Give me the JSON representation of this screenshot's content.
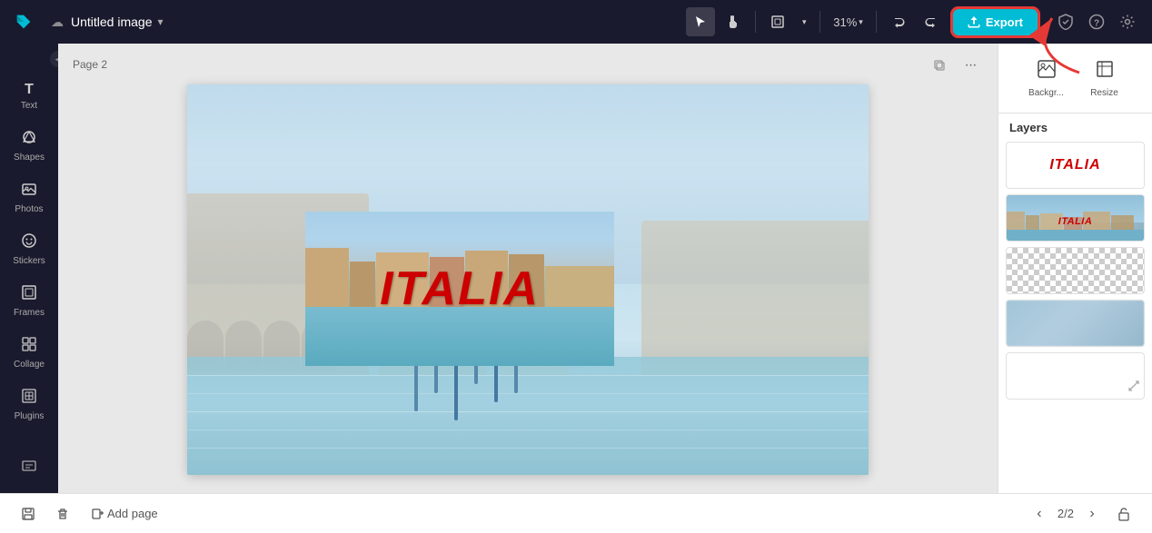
{
  "app": {
    "logo": "✕",
    "title": "Untitled image",
    "title_chevron": "▾"
  },
  "topbar": {
    "tools": {
      "select_label": "▶",
      "hand_label": "✋",
      "frame_label": "⊡",
      "zoom_value": "31%",
      "zoom_chevron": "▾",
      "undo_label": "↩",
      "redo_label": "↪"
    },
    "export_label": "Export",
    "shield_icon": "🛡",
    "help_icon": "?",
    "settings_icon": "⚙"
  },
  "sidebar": {
    "items": [
      {
        "id": "text",
        "icon": "T",
        "label": "Text"
      },
      {
        "id": "shapes",
        "icon": "⬡",
        "label": "Shapes"
      },
      {
        "id": "photos",
        "icon": "🖼",
        "label": "Photos"
      },
      {
        "id": "stickers",
        "icon": "☺",
        "label": "Stickers"
      },
      {
        "id": "frames",
        "icon": "⊞",
        "label": "Frames"
      },
      {
        "id": "collage",
        "icon": "⊟",
        "label": "Collage"
      },
      {
        "id": "plugins",
        "icon": "⊞",
        "label": "Plugins"
      }
    ],
    "collapse_icon": "◀"
  },
  "canvas": {
    "page_label": "Page 2",
    "italia_text": "ITALIA"
  },
  "right_sidebar": {
    "tools": [
      {
        "id": "background",
        "icon": "▣",
        "label": "Backgr..."
      },
      {
        "id": "resize",
        "icon": "⤢",
        "label": "Resize"
      }
    ],
    "layers_title": "Layers",
    "layers": [
      {
        "id": "italia-layer",
        "type": "text",
        "content": "ITALIA"
      },
      {
        "id": "photo-layer",
        "type": "photo"
      },
      {
        "id": "transparent-layer",
        "type": "transparent"
      },
      {
        "id": "blurred-layer",
        "type": "blurred"
      },
      {
        "id": "white-layer",
        "type": "white"
      }
    ]
  },
  "bottom_bar": {
    "save_icon": "💾",
    "delete_icon": "🗑",
    "add_page_label": "Add page",
    "page_current": "2/2",
    "prev_icon": "‹",
    "next_icon": "›",
    "unlock_icon": "🔓"
  }
}
